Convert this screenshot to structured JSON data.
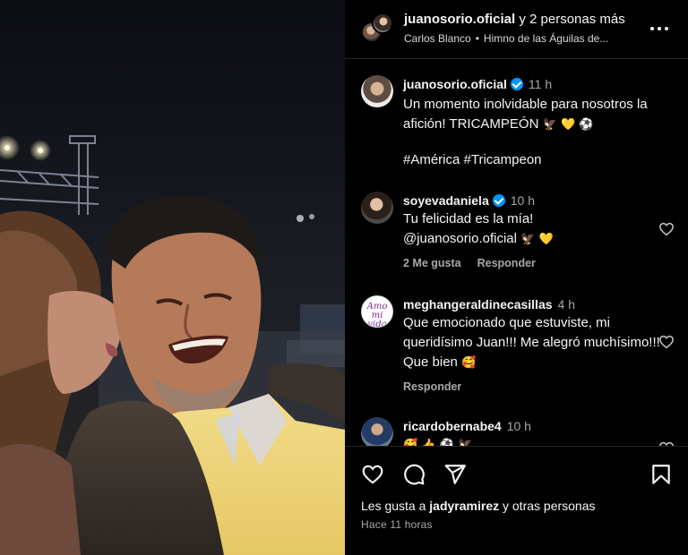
{
  "header": {
    "owner": "juanosorio.oficial",
    "owner_suffix": "y 2 personas más",
    "audio_artist": "Carlos Blanco",
    "audio_separator": "•",
    "audio_track": "Himno de las Águilas de...",
    "more_icon": "more-horizontal-icon"
  },
  "caption": {
    "username": "juanosorio.oficial",
    "time": "11 h",
    "text": "Un momento inolvidable para nosotros la afición! TRICAMPEÓN",
    "emojis": [
      "🦅",
      "💛",
      "⚽"
    ],
    "hashtags": "#América #Tricampeon"
  },
  "comments": [
    {
      "username": "soyevadaniela",
      "verified": true,
      "time": "10 h",
      "line1": "Tu felicidad es la mía!",
      "line2": "@juanosorio.oficial",
      "emojis": [
        "🦅",
        "💛"
      ],
      "likes": "2 Me gusta",
      "reply": "Responder"
    },
    {
      "username": "meghangeraldinecasillas",
      "time": "4 h",
      "text": "Que emocionado que estuviste, mi queridísimo Juan!!! Me alegró muchísimo!!! Que bien",
      "emoji": "🥰",
      "reply": "Responder",
      "avatar_text": "Amo mi vida"
    },
    {
      "username": "ricardobernabe4",
      "time": "10 h",
      "emojis": [
        "🥰",
        "👍",
        "⚽",
        "🦅"
      ]
    }
  ],
  "actions": {
    "like_icon": "heart-icon",
    "comment_icon": "comment-icon",
    "share_icon": "send-icon",
    "save_icon": "bookmark-icon",
    "likes_prefix": "Les gusta a",
    "likes_user": "jadyramirez",
    "likes_suffix": "y otras personas",
    "posted_ago": "Hace 11 horas"
  },
  "colors": {
    "background": "#000000",
    "text": "#f5f5f5",
    "secondary": "#a8a8a8",
    "verified": "#0095f6",
    "divider": "#262626"
  }
}
